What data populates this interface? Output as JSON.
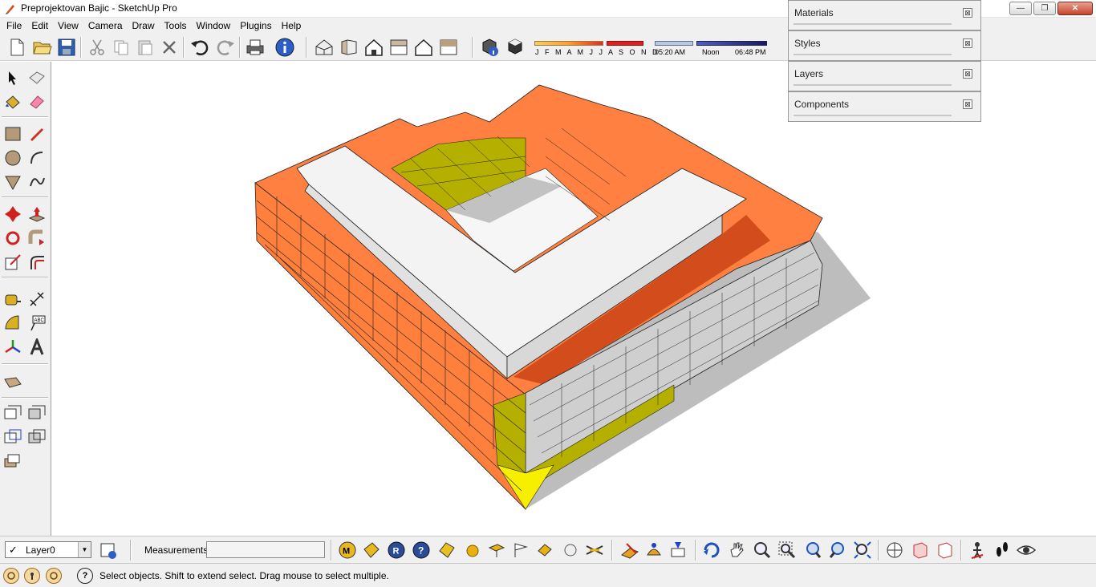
{
  "window": {
    "title": "Preprojektovan Bajic - SketchUp Pro",
    "min_glyph": "—",
    "max_glyph": "❐",
    "close_glyph": "✕"
  },
  "menu": [
    "File",
    "Edit",
    "View",
    "Camera",
    "Draw",
    "Tools",
    "Window",
    "Plugins",
    "Help"
  ],
  "shadow_settings": {
    "months": "J F M A M J J A S O N D",
    "time_start": "05:20 AM",
    "time_mid": "Noon",
    "time_end": "06:48 PM"
  },
  "tray": [
    {
      "title": "Materials",
      "close_glyph": "⊠"
    },
    {
      "title": "Styles",
      "close_glyph": "⊠"
    },
    {
      "title": "Layers",
      "close_glyph": "⊠"
    },
    {
      "title": "Components",
      "close_glyph": "⊠"
    }
  ],
  "layers": {
    "current": "Layer0",
    "check": "✓",
    "dropdown": "▼"
  },
  "measurements": {
    "label": "Measurements",
    "value": ""
  },
  "status": {
    "text": "Select objects. Shift to extend select. Drag mouse to select multiple.",
    "help_glyph": "?"
  },
  "colors": {
    "roof_orange": "#ff8040",
    "wall_orange": "#ff7f3c",
    "olive": "#b5b000",
    "yellow": "#f6f000",
    "white_block": "#f3f3f3",
    "shadow": "#bdbdbd",
    "grey_face": "#cfcfcf"
  }
}
